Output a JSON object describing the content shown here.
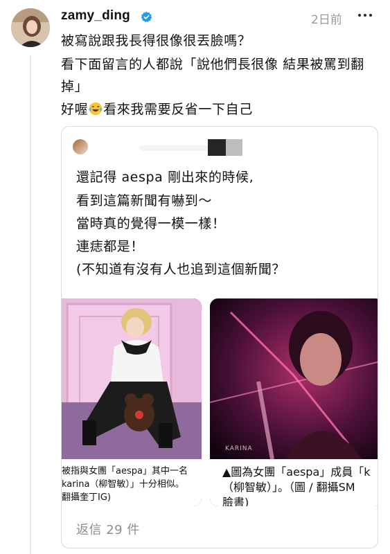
{
  "post": {
    "username": "zamy_ding",
    "timestamp": "2日前",
    "text_lines": [
      "被寫說跟我長得很像很丟臉嗎？",
      "看下面留言的人都說「說他們長很像 結果被罵到翻",
      "掉」"
    ],
    "last_line_before_emoji": "好喔",
    "last_line_after_emoji": "看來我需要反省一下自己",
    "emoji": "face-with-tears-of-joy"
  },
  "quote": {
    "text_lines": [
      "還記得 aespa 剛出來的時候,",
      "看到這篇新聞有嚇到～",
      "當時真的覺得一模一樣！",
      "連痣都是！",
      "(不知道有沒有人也追到這個新聞？"
    ],
    "media": [
      {
        "caption_lines": [
          "被指與女團「aespa」其中一名",
          "karina（柳智敏）」十分相似。",
          "翻攝奎丁IG)"
        ]
      },
      {
        "caption_lines": [
          "▲圖為女團「aespa」成員「k",
          "（柳智敏）」。（圖 / 翻攝SM",
          "臉書)"
        ],
        "watermark": "KARINA"
      }
    ],
    "replies_label": "返信 29 件"
  },
  "colors": {
    "verified": "#1d9bf0",
    "muted": "#9a9a9a",
    "border": "#d9d9d9"
  }
}
